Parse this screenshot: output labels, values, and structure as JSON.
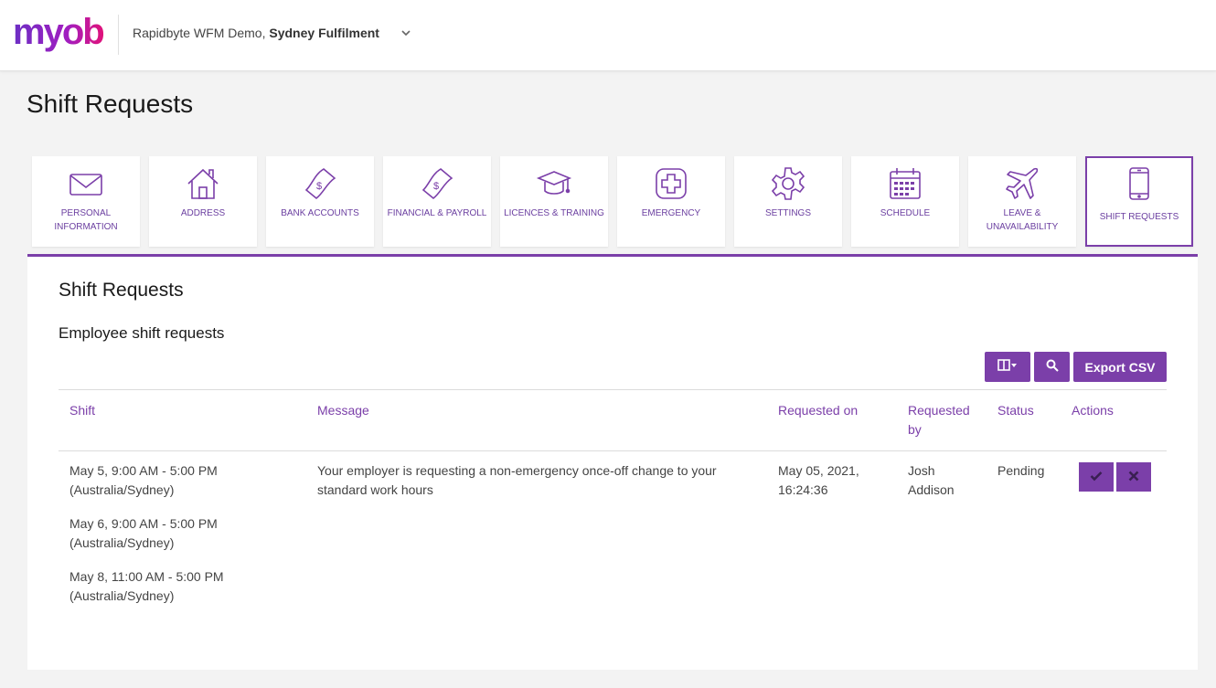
{
  "header": {
    "logo_text": "myob",
    "org_prefix": "Rapidbyte WFM Demo,",
    "org_name": "Sydney Fulfilment"
  },
  "page_title": "Shift Requests",
  "tiles": [
    {
      "label": "PERSONAL INFORMATION",
      "icon": "envelope-icon"
    },
    {
      "label": "ADDRESS",
      "icon": "house-icon"
    },
    {
      "label": "BANK ACCOUNTS",
      "icon": "money-icon"
    },
    {
      "label": "FINANCIAL & PAYROLL",
      "icon": "money-icon"
    },
    {
      "label": "LICENCES & TRAINING",
      "icon": "graduation-cap-icon"
    },
    {
      "label": "EMERGENCY",
      "icon": "medical-cross-icon"
    },
    {
      "label": "SETTINGS",
      "icon": "gear-icon"
    },
    {
      "label": "SCHEDULE",
      "icon": "calendar-icon"
    },
    {
      "label": "LEAVE & UNAVAILABILITY",
      "icon": "airplane-icon"
    },
    {
      "label": "SHIFT REQUESTS",
      "icon": "mobile-phone-icon",
      "active": true
    }
  ],
  "section": {
    "title": "Shift Requests",
    "subtitle": "Employee shift requests"
  },
  "toolbar": {
    "columns_icon": "columns-dropdown-icon",
    "search_icon": "search-icon",
    "export_label": "Export CSV"
  },
  "table": {
    "headers": {
      "shift": "Shift",
      "message": "Message",
      "requested_on": "Requested on",
      "requested_by": "Requested by",
      "status": "Status",
      "actions": "Actions"
    },
    "rows": [
      {
        "shifts": [
          {
            "time": "May 5, 9:00 AM - 5:00 PM",
            "tz": "(Australia/Sydney)"
          },
          {
            "time": "May 6, 9:00 AM - 5:00 PM",
            "tz": "(Australia/Sydney)"
          },
          {
            "time": "May 8, 11:00 AM - 5:00 PM",
            "tz": "(Australia/Sydney)"
          }
        ],
        "message": "Your employer is requesting a non-emergency once-off change to your standard work hours",
        "requested_on": "May 05, 2021, 16:24:36",
        "requested_by": "Josh Addison",
        "status": "Pending",
        "actions": [
          "check-icon",
          "cross-icon"
        ]
      }
    ]
  },
  "colors": {
    "accent": "#7b3fa9",
    "page_bg": "#f3f3f3"
  }
}
